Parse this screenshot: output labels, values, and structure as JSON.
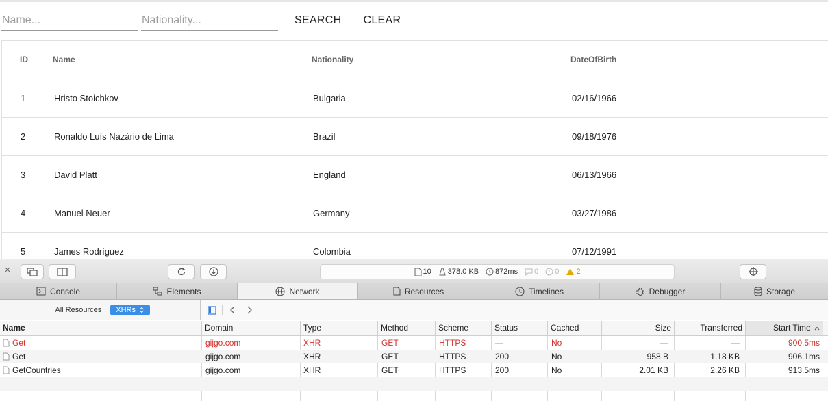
{
  "search": {
    "name_placeholder": "Name...",
    "nationality_placeholder": "Nationality...",
    "search_label": "SEARCH",
    "clear_label": "CLEAR"
  },
  "grid": {
    "headers": {
      "id": "ID",
      "name": "Name",
      "nationality": "Nationality",
      "dob": "DateOfBirth"
    },
    "rows": [
      {
        "id": "1",
        "name": "Hristo Stoichkov",
        "nationality": "Bulgaria",
        "dob": "02/16/1966"
      },
      {
        "id": "2",
        "name": "Ronaldo Luís Nazário de Lima",
        "nationality": "Brazil",
        "dob": "09/18/1976"
      },
      {
        "id": "3",
        "name": "David Platt",
        "nationality": "England",
        "dob": "06/13/1966"
      },
      {
        "id": "4",
        "name": "Manuel Neuer",
        "nationality": "Germany",
        "dob": "03/27/1986"
      },
      {
        "id": "5",
        "name": "James Rodríguez",
        "nationality": "Colombia",
        "dob": "07/12/1991"
      }
    ]
  },
  "devtools": {
    "stats": {
      "resources": "10",
      "size": "378.0 KB",
      "time": "872ms",
      "logs": "0",
      "errors": "0",
      "warnings": "2"
    },
    "tabs": [
      "Console",
      "Elements",
      "Network",
      "Resources",
      "Timelines",
      "Debugger",
      "Storage"
    ],
    "scope_label": "All Resources",
    "filter_label": "XHRs",
    "columns": {
      "name": "Name",
      "domain": "Domain",
      "type": "Type",
      "method": "Method",
      "scheme": "Scheme",
      "status": "Status",
      "cached": "Cached",
      "size": "Size",
      "transferred": "Transferred",
      "start_time": "Start Time"
    },
    "requests": [
      {
        "name": "Get",
        "domain": "gijgo.com",
        "type": "XHR",
        "method": "GET",
        "scheme": "HTTPS",
        "status": "—",
        "cached": "No",
        "size": "—",
        "transferred": "—",
        "start_time": "900.5ms"
      },
      {
        "name": "Get",
        "domain": "gijgo.com",
        "type": "XHR",
        "method": "GET",
        "scheme": "HTTPS",
        "status": "200",
        "cached": "No",
        "size": "958 B",
        "transferred": "1.18 KB",
        "start_time": "906.1ms"
      },
      {
        "name": "GetCountries",
        "domain": "gijgo.com",
        "type": "XHR",
        "method": "GET",
        "scheme": "HTTPS",
        "status": "200",
        "cached": "No",
        "size": "2.01 KB",
        "transferred": "2.26 KB",
        "start_time": "913.5ms"
      }
    ],
    "colors": {
      "accent": "#3a8ee6",
      "error": "#d3302a",
      "warning": "#e0a800"
    }
  }
}
